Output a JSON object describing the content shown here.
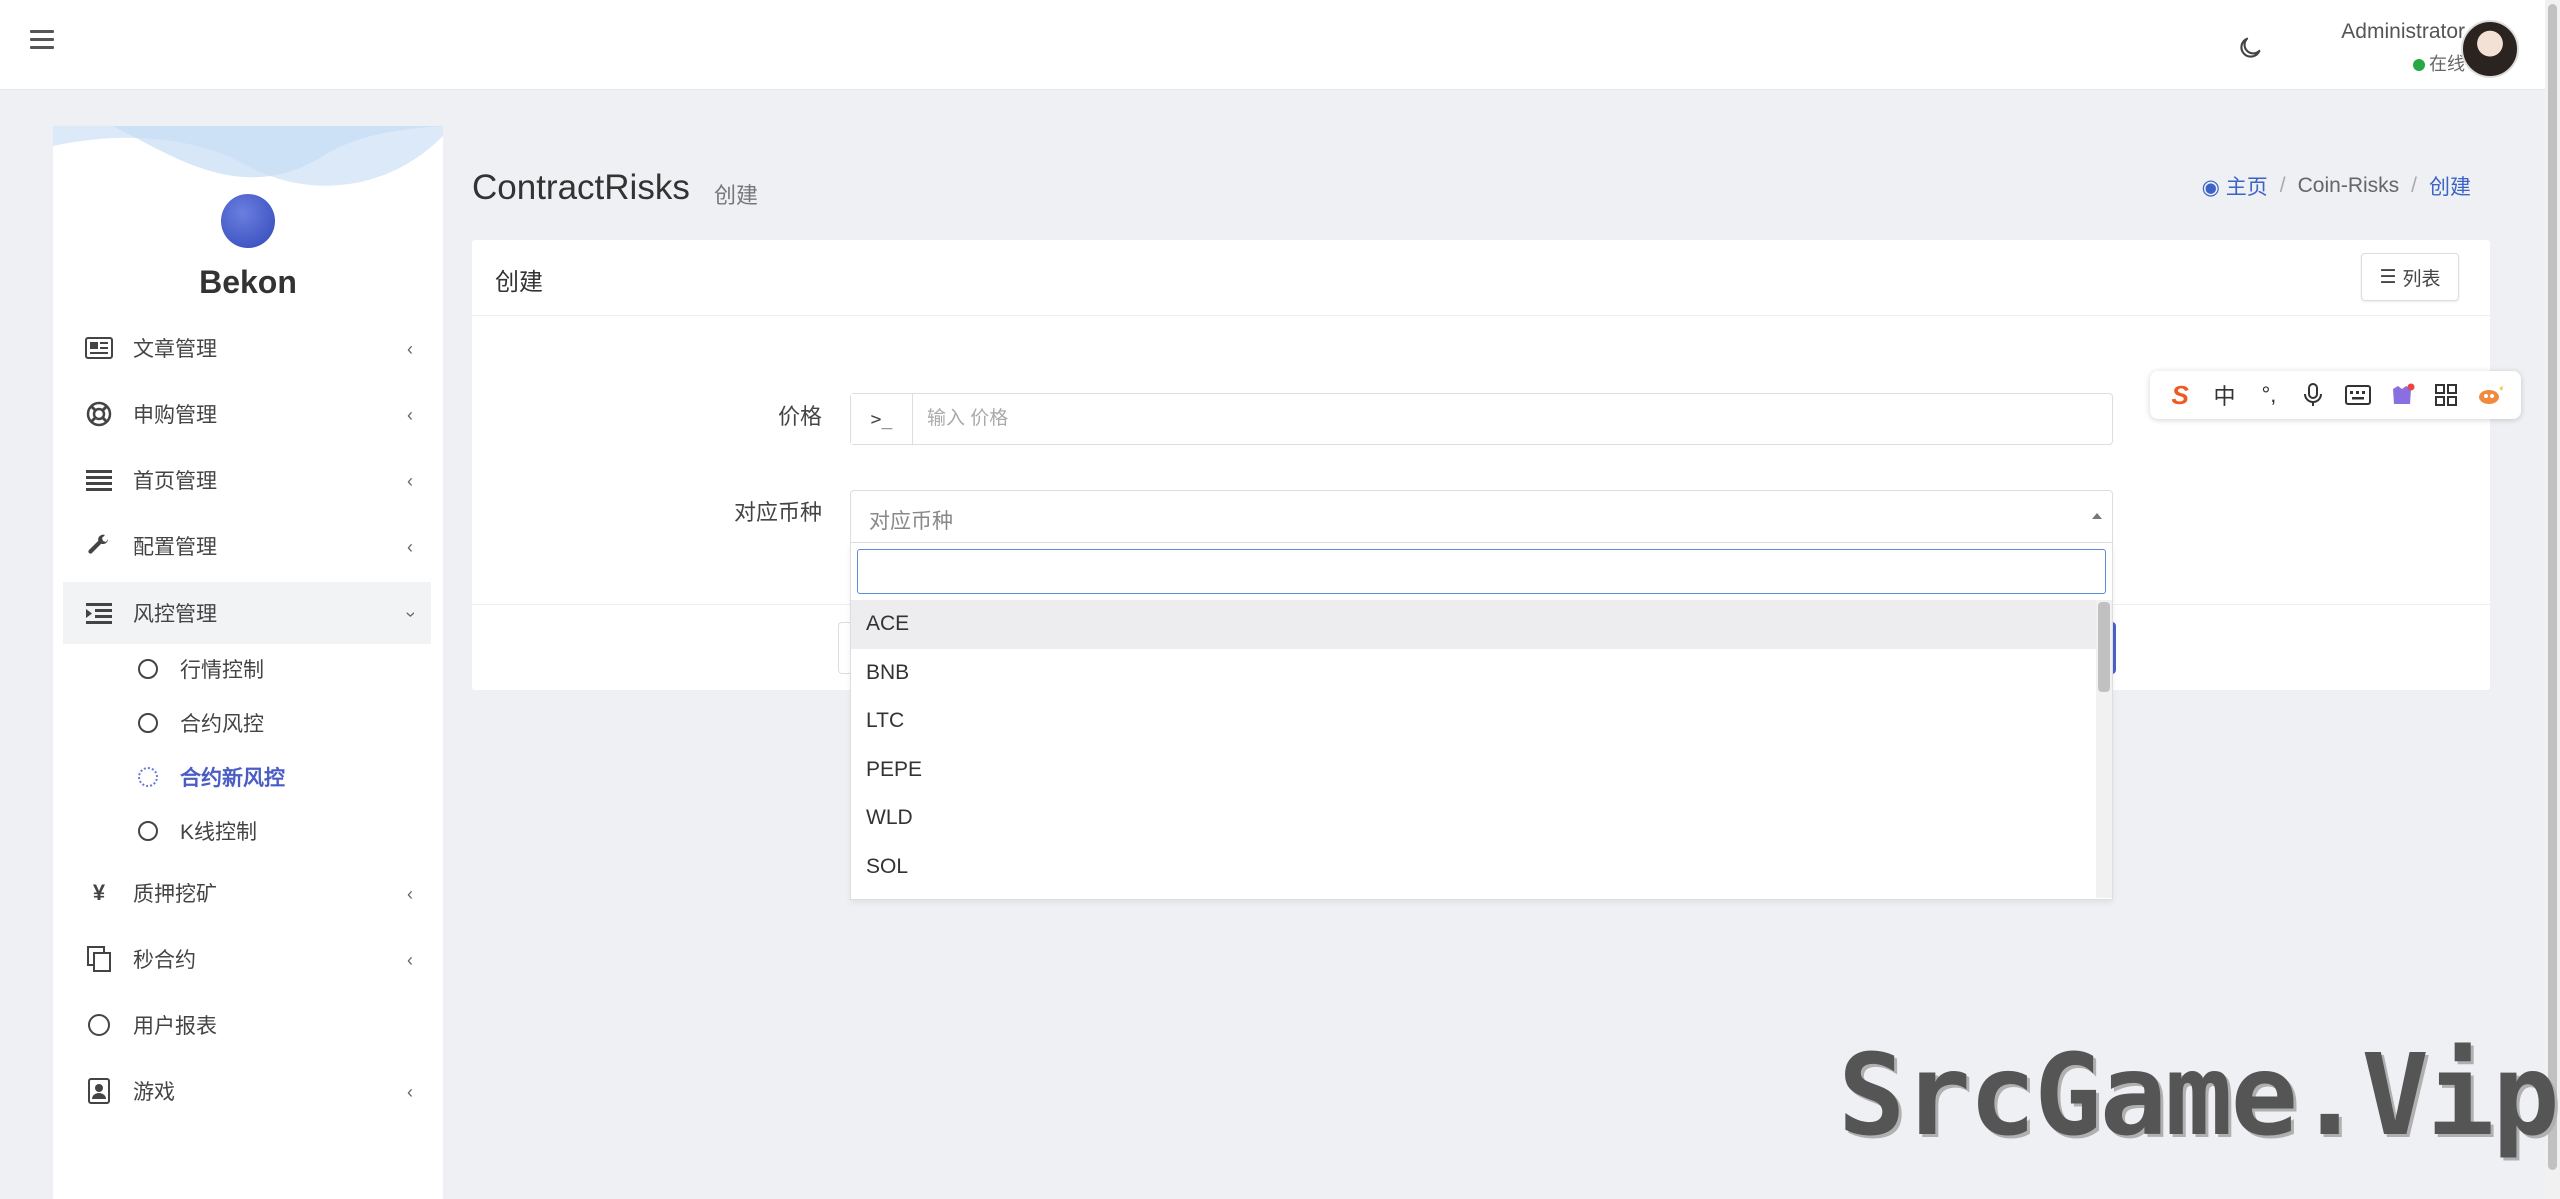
{
  "header": {
    "user_name": "Administrator",
    "user_status": "在线"
  },
  "sidebar": {
    "brand": "Bekon",
    "items": [
      {
        "label": "文章管理",
        "icon": "newspaper-icon"
      },
      {
        "label": "申购管理",
        "icon": "life-ring-icon"
      },
      {
        "label": "首页管理",
        "icon": "list-icon"
      },
      {
        "label": "配置管理",
        "icon": "wrench-icon"
      },
      {
        "label": "风控管理",
        "icon": "indent-icon"
      },
      {
        "label": "质押挖矿",
        "icon": "yen-icon"
      },
      {
        "label": "秒合约",
        "icon": "copy-icon"
      },
      {
        "label": "用户报表",
        "icon": "circle-icon"
      },
      {
        "label": "游戏",
        "icon": "id-card-icon"
      }
    ],
    "sub_items": [
      {
        "label": "行情控制"
      },
      {
        "label": "合约风控"
      },
      {
        "label": "合约新风控"
      },
      {
        "label": "K线控制"
      }
    ]
  },
  "page": {
    "title": "ContractRisks",
    "subtitle": "创建"
  },
  "breadcrumb": {
    "home": "主页",
    "section": "Coin-Risks",
    "current": "创建"
  },
  "card": {
    "title": "创建",
    "list_button": "列表"
  },
  "form": {
    "price_label": "价格",
    "price_placeholder": "输入 价格",
    "price_addon": ">_",
    "coin_label": "对应币种",
    "coin_placeholder": "对应币种",
    "coin_options": [
      "ACE",
      "BNB",
      "LTC",
      "PEPE",
      "WLD",
      "SOL"
    ]
  },
  "ime": {
    "mode": "中",
    "punct": "°,"
  },
  "watermark": "SrcGame.Vip",
  "colors": {
    "accent": "#4b63c9",
    "link": "#3c63c5",
    "online": "#28a745",
    "background": "#eef0f4"
  }
}
